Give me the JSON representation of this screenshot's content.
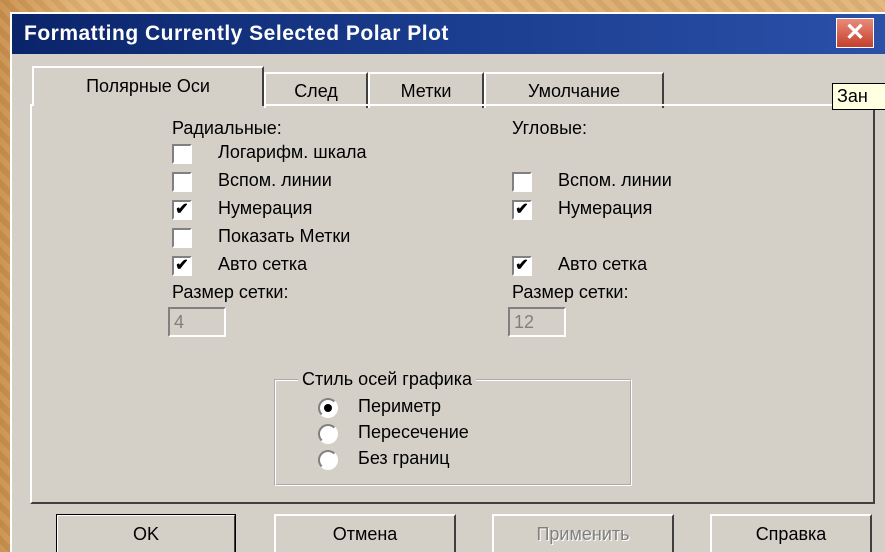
{
  "dialog": {
    "title": "Formatting Currently Selected Polar Plot",
    "close_glyph": "✕"
  },
  "tabs": [
    {
      "label": "Полярные Оси",
      "active": true
    },
    {
      "label": "След",
      "active": false
    },
    {
      "label": "Метки",
      "active": false
    },
    {
      "label": "Умолчание",
      "active": false
    }
  ],
  "tooltip": {
    "text": "Зан"
  },
  "radial": {
    "heading": "Радиальные:",
    "options": [
      {
        "label": "Логарифм. шкала",
        "checked": false
      },
      {
        "label": "Вспом. линии",
        "checked": false
      },
      {
        "label": "Нумерация",
        "checked": true
      },
      {
        "label": "Показать Метки",
        "checked": false
      },
      {
        "label": "Авто сетка",
        "checked": true
      }
    ],
    "grid_size_label": "Размер сетки:",
    "grid_size_value": "4"
  },
  "angular": {
    "heading": "Угловые:",
    "options": [
      {
        "label": "Вспом. линии",
        "checked": false
      },
      {
        "label": "Нумерация",
        "checked": true
      },
      {
        "label": "Авто сетка",
        "checked": true
      }
    ],
    "grid_size_label": "Размер сетки:",
    "grid_size_value": "12"
  },
  "axes_style": {
    "legend": "Стиль осей графика",
    "options": [
      {
        "label": "Периметр",
        "selected": true
      },
      {
        "label": "Пересечение",
        "selected": false
      },
      {
        "label": "Без границ",
        "selected": false
      }
    ]
  },
  "buttons": {
    "ok": "OK",
    "cancel": "Отмена",
    "apply": "Применить",
    "help": "Справка"
  },
  "check_glyph": "✔"
}
